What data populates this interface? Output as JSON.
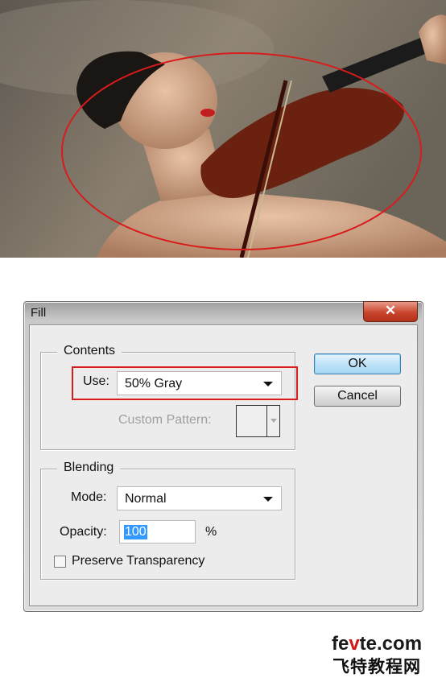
{
  "dialog": {
    "title": "Fill",
    "close_icon": "close-icon",
    "contents": {
      "group_label": "Contents",
      "use_label": "Use:",
      "use_value": "50% Gray",
      "custom_pattern_label": "Custom Pattern:"
    },
    "blending": {
      "group_label": "Blending",
      "mode_label": "Mode:",
      "mode_value": "Normal",
      "opacity_label": "Opacity:",
      "opacity_value": "100",
      "opacity_unit": "%",
      "preserve_label": "Preserve Transparency",
      "preserve_checked": false
    },
    "ok_label": "OK",
    "cancel_label": "Cancel"
  },
  "watermark": {
    "line1_a": "fe",
    "line1_b": "v",
    "line1_c": "te.com",
    "line2": "飞特教程网"
  },
  "colors": {
    "highlight": "#d81c1c",
    "default_button": "#bfe3f8",
    "selection": "#3399ff"
  }
}
